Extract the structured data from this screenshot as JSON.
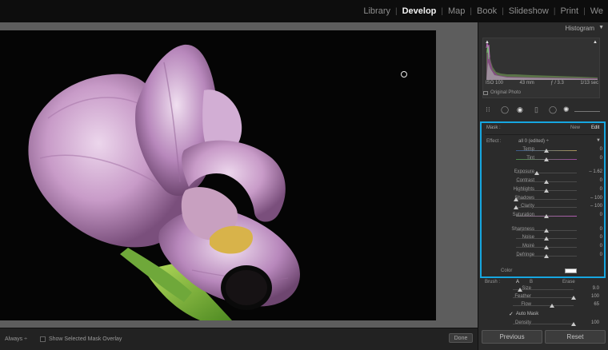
{
  "modules": [
    {
      "label": "Library",
      "active": false
    },
    {
      "label": "Develop",
      "active": true
    },
    {
      "label": "Map",
      "active": false
    },
    {
      "label": "Book",
      "active": false
    },
    {
      "label": "Slideshow",
      "active": false
    },
    {
      "label": "Print",
      "active": false
    },
    {
      "label": "We",
      "active": false
    }
  ],
  "module_separator": "|",
  "histogram": {
    "title": "Histogram",
    "toggle": "▼",
    "iso": "ISO 100",
    "focal": "43 mm",
    "aperture": "ƒ / 3.3",
    "shutter": "1/13 sec",
    "original_photo": "Original Photo"
  },
  "mask_panel": {
    "label": "Mask :",
    "new": "New",
    "edit": "Edit",
    "effect_label": "Effect :",
    "effect_value": "all 0 (edited) ÷",
    "effect_toggle": "▼",
    "color_label": "Color",
    "sliders": [
      {
        "label": "Temp",
        "value": "0",
        "pos": 0.5
      },
      {
        "label": "Tint",
        "value": "0",
        "pos": 0.5
      },
      {
        "label": "Exposure",
        "value": "– 1.62",
        "pos": 0.34
      },
      {
        "label": "Contrast",
        "value": "0",
        "pos": 0.5
      },
      {
        "label": "Highlights",
        "value": "0",
        "pos": 0.5
      },
      {
        "label": "Shadows",
        "value": "– 100",
        "pos": 0.0
      },
      {
        "label": "Clarity",
        "value": "– 100",
        "pos": 0.0
      },
      {
        "label": "Saturation",
        "value": "0",
        "pos": 0.5
      },
      {
        "label": "Sharpness",
        "value": "0",
        "pos": 0.5
      },
      {
        "label": "Noise",
        "value": "0",
        "pos": 0.5
      },
      {
        "label": "Moiré",
        "value": "0",
        "pos": 0.5
      },
      {
        "label": "Defringe",
        "value": "0",
        "pos": 0.5
      }
    ]
  },
  "brush": {
    "label": "Brush :",
    "a": "A",
    "b": "B",
    "erase": "Erase",
    "sliders": [
      {
        "label": "Size",
        "value": "9.0",
        "pos": 0.12
      },
      {
        "label": "Feather",
        "value": "100",
        "pos": 1.0
      },
      {
        "label": "Flow",
        "value": "65",
        "pos": 0.65
      }
    ],
    "auto_mask": "Auto Mask",
    "auto_mask_check": "✓",
    "density": {
      "label": "Density",
      "value": "100",
      "pos": 1.0
    }
  },
  "toolbar": {
    "overlay_select": "Always ÷",
    "show_overlay": "Show Selected Mask Overlay",
    "done": "Done"
  },
  "buttons": {
    "previous": "Previous",
    "reset": "Reset"
  },
  "colors": {
    "accent": "#16a6e0",
    "flower": "#c89bc8",
    "stem": "#8dc63f"
  },
  "icons": {
    "grid": "grid-icon",
    "crop": "crop-icon",
    "spot": "spot-removal-icon",
    "redeye": "red-eye-icon",
    "graduated": "graduated-filter-icon",
    "radial": "radial-filter-icon",
    "brush": "adjustment-brush-icon"
  }
}
